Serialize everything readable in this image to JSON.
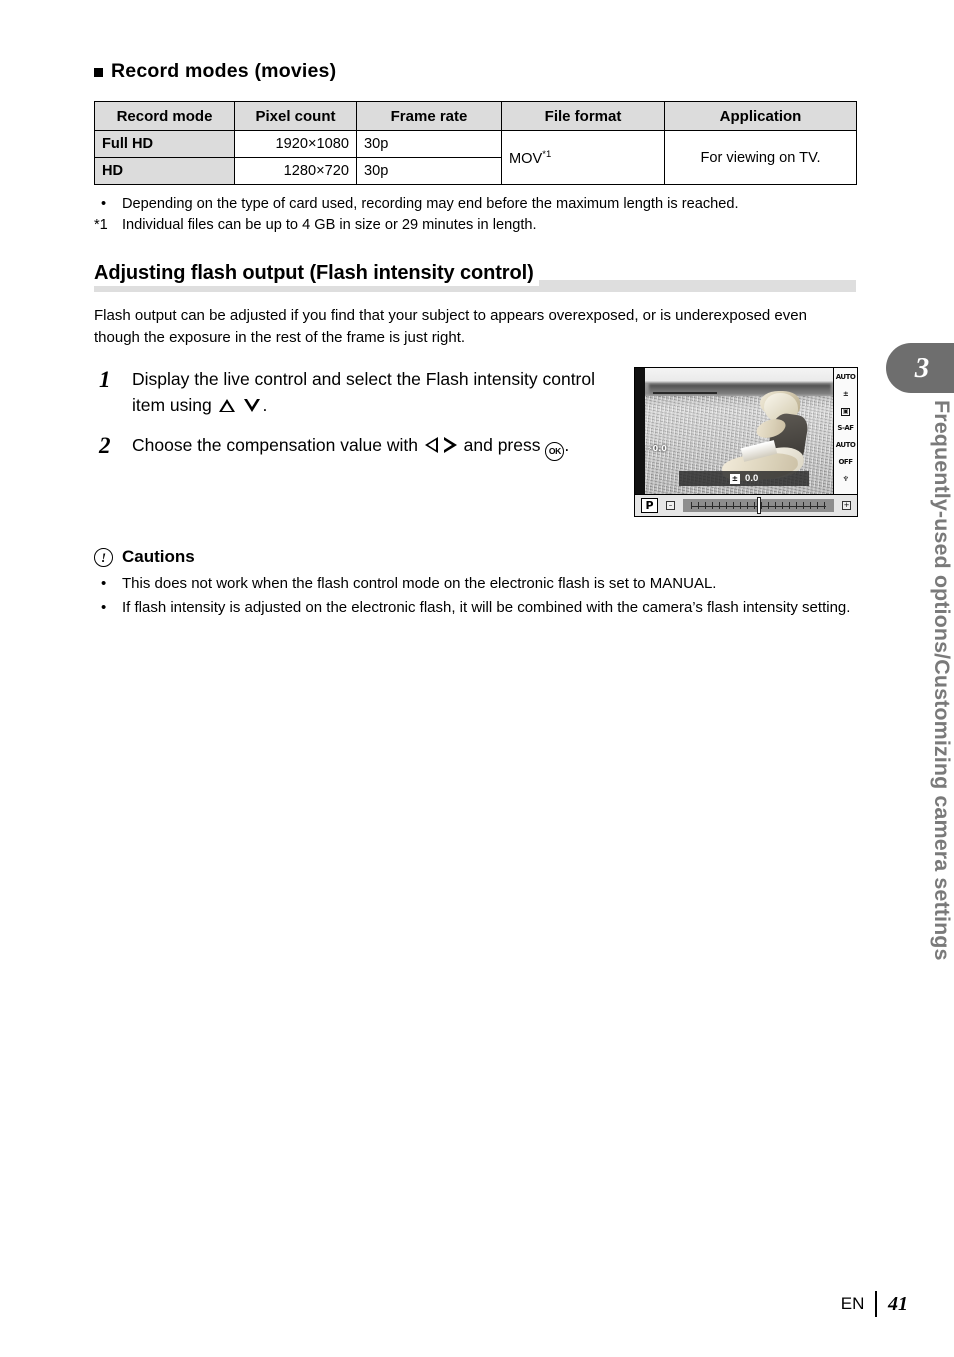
{
  "section": {
    "heading": "Record modes (movies)"
  },
  "table": {
    "headers": [
      "Record mode",
      "Pixel count",
      "Frame rate",
      "File format",
      "Application"
    ],
    "rows": [
      {
        "mode": "Full HD",
        "pixels": "1920×1080",
        "framerate": "30p"
      },
      {
        "mode": "HD",
        "pixels": "1280×720",
        "framerate": "30p"
      }
    ],
    "file_format": "MOV",
    "file_format_footnote": "*1",
    "application": "For viewing on TV."
  },
  "notes": [
    {
      "mark": "•",
      "text": "Depending on the type of card used, recording may end before the maximum length is reached."
    },
    {
      "mark": "*1",
      "text": "Individual files can be up to 4 GB in size or 29 minutes in length."
    }
  ],
  "topic": {
    "heading": "Adjusting flash output (Flash intensity control)",
    "intro": "Flash output can be adjusted if you find that your subject to appears overexposed, or is underexposed even though the exposure in the rest of the frame is just right."
  },
  "steps": [
    {
      "number": "1",
      "text_before": "Display the live control and select the Flash intensity control item using",
      "icons": [
        "up-triangle-icon",
        "down-triangle-icon"
      ],
      "text_after": "."
    },
    {
      "number": "2",
      "text_before": "Choose the compensation value with",
      "icons": [
        "left-triangle-icon",
        "right-triangle-icon"
      ],
      "text_middle": "and press",
      "button": "OK",
      "text_after": "."
    }
  ],
  "camera_screen": {
    "flash_value_overlay": "0.0",
    "osd_badge": "±",
    "osd_value": "0.0",
    "mode": "P",
    "exposure_minus": "–",
    "exposure_plus": "+",
    "sidebar_icons": [
      "flash-auto-icon",
      "flash-compensation-icon",
      "metering-icon",
      "af-mode-icon",
      "white-balance-auto-icon",
      "face-detect-off-icon",
      "movie-sound-icon"
    ],
    "sidebar_labels": [
      "AUTO",
      "±",
      "▣",
      "S-AF",
      "AUTO",
      "OFF",
      ""
    ]
  },
  "cautions": {
    "icon": "caution-exclamation-icon",
    "heading": "Cautions",
    "items": [
      {
        "mark": "•",
        "text": "This does not work when the flash control mode on the electronic flash is set to MANUAL."
      },
      {
        "mark": "•",
        "text": "If flash intensity is adjusted on the electronic flash, it will be combined with the camera’s flash intensity setting."
      }
    ]
  },
  "chapter": {
    "number": "3",
    "title": "Frequently-used options/Customizing camera settings"
  },
  "footer": {
    "language": "EN",
    "page": "41"
  },
  "colors": {
    "table_header_bg": "#dcdcdc",
    "heading_bar": "#dedede",
    "chapter_tab": "#6e6e6e",
    "chapter_title": "#7a7a7a"
  }
}
